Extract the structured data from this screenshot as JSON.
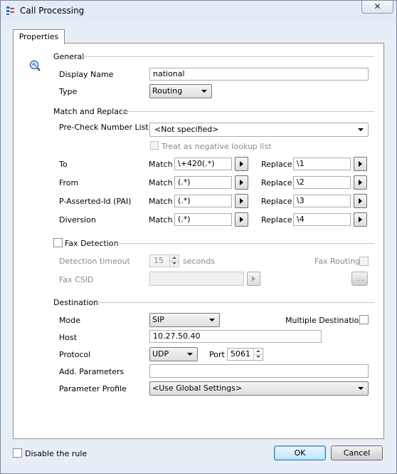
{
  "window": {
    "title": "Call Processing",
    "close_glyph": "✕"
  },
  "tabs": [
    {
      "label": "Properties"
    }
  ],
  "general": {
    "section": "General",
    "display_name_label": "Display Name",
    "display_name_value": "national",
    "type_label": "Type",
    "type_value": "Routing"
  },
  "match_replace": {
    "section": "Match and Replace",
    "precheck_label": "Pre-Check Number List",
    "precheck_value": "<Not specified>",
    "negative_label": "Treat as negative lookup list",
    "match_label": "Match",
    "replace_label": "Replace",
    "rows": [
      {
        "name": "To",
        "match": "\\+420(.*)",
        "replace": "\\1"
      },
      {
        "name": "From",
        "match": "(.*)",
        "replace": "\\2"
      },
      {
        "name": "P-Asserted-Id (PAI)",
        "match": "(.*)",
        "replace": "\\3"
      },
      {
        "name": "Diversion",
        "match": "(.*)",
        "replace": "\\4"
      }
    ]
  },
  "fax": {
    "section": "Fax Detection",
    "timeout_label": "Detection timeout",
    "timeout_value": "15",
    "timeout_unit": "seconds",
    "routing_label": "Fax Routing",
    "csid_label": "Fax CSID",
    "csid_value": "",
    "browse_label": "..."
  },
  "destination": {
    "section": "Destination",
    "mode_label": "Mode",
    "mode_value": "SIP",
    "multiple_label": "Multiple Destinations",
    "host_label": "Host",
    "host_value": "10.27.50.40",
    "protocol_label": "Protocol",
    "protocol_value": "UDP",
    "port_label": "Port",
    "port_value": "5061",
    "add_params_label": "Add. Parameters",
    "add_params_value": "",
    "profile_label": "Parameter Profile",
    "profile_value": "<Use Global Settings>"
  },
  "footer": {
    "disable_label": "Disable the rule",
    "ok_label": "OK",
    "cancel_label": "Cancel"
  },
  "colors": {
    "accent": "#3c7fb1",
    "icon": "#2f6fc0"
  }
}
